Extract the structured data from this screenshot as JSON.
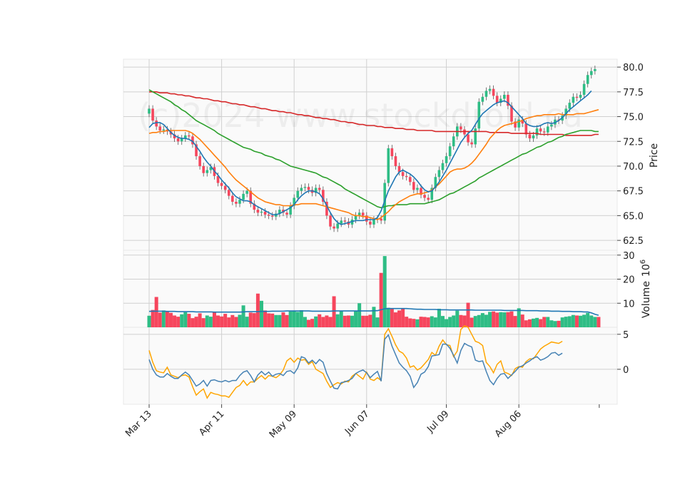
{
  "watermark": "(c)2024 www.stockdroid.ca",
  "colors": {
    "up": "#2ebd85",
    "down": "#f6465d",
    "panel_bg": "#fafafa",
    "grid": "#d0d0d0",
    "ma_fast": "#1f77b4",
    "ma_mid": "#ff7f0e",
    "ma_slow": "#2ca02c",
    "ma_long": "#d62728",
    "vol_ma": "#1f77b4",
    "osc_a": "#4682b4",
    "osc_b": "#ffa500"
  },
  "chart_data": {
    "type": "candlestick",
    "x_ticks": [
      "Mar 13",
      "Apr 11",
      "May 09",
      "Jun 07",
      "Jul 09",
      "Aug 06"
    ],
    "price_panel": {
      "ylabel": "Price",
      "yticks": [
        "62.5",
        "65.0",
        "67.5",
        "70.0",
        "72.5",
        "75.0",
        "77.5",
        "80.0"
      ],
      "ylim": [
        61.5,
        80.8
      ],
      "close": [
        75.8,
        74.6,
        74.0,
        73.6,
        73.7,
        73.5,
        73.2,
        72.8,
        72.5,
        72.8,
        73.1,
        73.0,
        72.2,
        71.0,
        70.0,
        69.3,
        69.6,
        69.9,
        69.0,
        68.3,
        68.0,
        67.6,
        67.0,
        66.4,
        66.2,
        66.6,
        67.2,
        67.5,
        66.2,
        65.6,
        65.3,
        65.4,
        65.1,
        65.0,
        64.9,
        65.2,
        65.6,
        65.3,
        65.1,
        66.0,
        66.8,
        67.5,
        67.8,
        67.9,
        67.6,
        67.3,
        67.8,
        67.6,
        66.4,
        65.0,
        63.9,
        63.7,
        64.2,
        64.5,
        64.4,
        64.1,
        64.6,
        65.0,
        65.3,
        65.0,
        64.4,
        64.1,
        64.6,
        64.7,
        64.5,
        68.3,
        71.8,
        71.0,
        70.0,
        69.4,
        69.0,
        68.9,
        68.4,
        67.6,
        67.8,
        67.1,
        66.8,
        66.6,
        67.8,
        68.9,
        69.6,
        70.3,
        71.0,
        72.0,
        73.0,
        74.0,
        73.7,
        73.2,
        72.4,
        72.2,
        73.8,
        76.5,
        77.0,
        77.6,
        77.8,
        77.1,
        76.4,
        76.8,
        77.2,
        76.1,
        74.5,
        73.9,
        74.7,
        74.3,
        73.2,
        72.8,
        73.1,
        73.8,
        73.5,
        73.4,
        74.0,
        74.2,
        74.7,
        74.6,
        75.1,
        75.8,
        76.4,
        77.0,
        76.9,
        77.2,
        78.3,
        79.2,
        79.6,
        79.8
      ],
      "ma_fast": [
        73.9,
        74.3,
        74.4,
        74.4,
        74.2,
        73.8,
        73.4,
        73.1,
        72.9,
        72.8,
        72.8,
        72.7,
        72.5,
        72.0,
        71.5,
        70.9,
        70.4,
        70.0,
        69.5,
        69.1,
        68.6,
        68.2,
        67.8,
        67.3,
        66.9,
        66.7,
        66.5,
        66.5,
        66.4,
        66.1,
        65.9,
        65.7,
        65.5,
        65.3,
        65.1,
        65.1,
        65.2,
        65.4,
        65.6,
        65.8,
        66.1,
        66.6,
        67.0,
        67.3,
        67.5,
        67.5,
        67.4,
        67.2,
        66.7,
        66.0,
        65.3,
        64.7,
        64.3,
        64.1,
        64.2,
        64.3,
        64.4,
        64.5,
        64.5,
        64.5,
        64.6,
        64.6,
        64.6,
        64.8,
        65.5,
        66.5,
        67.5,
        68.2,
        68.9,
        69.4,
        69.6,
        69.4,
        69.2,
        68.9,
        68.5,
        68.0,
        67.6,
        67.4,
        67.5,
        67.9,
        68.4,
        69.0,
        69.6,
        70.3,
        71.0,
        71.7,
        72.4,
        72.9,
        73.3,
        73.6,
        74.2,
        74.8,
        75.3,
        75.6,
        75.9,
        76.2,
        76.4,
        76.5,
        76.6,
        76.4,
        76.0,
        75.6,
        75.2,
        74.8,
        74.3,
        74.1,
        74.0,
        74.0,
        74.1,
        74.3,
        74.4,
        74.3,
        74.4,
        74.6,
        74.9,
        75.3,
        75.7,
        76.0,
        76.3,
        76.6,
        76.9,
        77.2,
        77.6
      ],
      "ma_mid": [
        73.3,
        73.4,
        73.4,
        73.5,
        73.5,
        73.6,
        73.6,
        73.6,
        73.6,
        73.6,
        73.6,
        73.5,
        73.3,
        73.0,
        72.7,
        72.3,
        71.9,
        71.5,
        71.1,
        70.7,
        70.3,
        69.9,
        69.4,
        69.0,
        68.6,
        68.3,
        68.0,
        67.7,
        67.4,
        67.1,
        66.8,
        66.6,
        66.4,
        66.3,
        66.2,
        66.1,
        66.1,
        66.0,
        66.0,
        66.0,
        66.1,
        66.1,
        66.2,
        66.2,
        66.2,
        66.2,
        66.2,
        66.1,
        66.0,
        65.9,
        65.8,
        65.7,
        65.6,
        65.5,
        65.4,
        65.3,
        65.1,
        65.0,
        65.0,
        64.9,
        64.9,
        64.8,
        64.7,
        64.6,
        64.8,
        65.1,
        65.4,
        65.8,
        66.1,
        66.4,
        66.6,
        66.8,
        67.0,
        67.1,
        67.2,
        67.2,
        67.3,
        67.4,
        67.6,
        67.9,
        68.2,
        68.6,
        69.0,
        69.4,
        69.6,
        69.7,
        69.7,
        69.8,
        70.0,
        70.3,
        70.7,
        71.2,
        71.7,
        72.2,
        72.8,
        73.2,
        73.6,
        73.9,
        74.1,
        74.2,
        74.3,
        74.4,
        74.5,
        74.6,
        74.8,
        74.9,
        75.0,
        75.1,
        75.1,
        75.2,
        75.2,
        75.2,
        75.2,
        75.3,
        75.2,
        75.2,
        75.2,
        75.2,
        75.3,
        75.3,
        75.3,
        75.4,
        75.5,
        75.6,
        75.7
      ],
      "ma_slow": [
        77.7,
        77.5,
        77.3,
        77.1,
        76.9,
        76.7,
        76.5,
        76.2,
        76.0,
        75.7,
        75.5,
        75.2,
        74.9,
        74.6,
        74.4,
        74.2,
        74.0,
        73.8,
        73.6,
        73.3,
        73.1,
        72.9,
        72.7,
        72.5,
        72.3,
        72.1,
        71.9,
        71.8,
        71.7,
        71.5,
        71.4,
        71.3,
        71.1,
        71.0,
        70.9,
        70.7,
        70.6,
        70.4,
        70.2,
        70.0,
        69.9,
        69.8,
        69.7,
        69.6,
        69.5,
        69.4,
        69.3,
        69.1,
        68.9,
        68.8,
        68.6,
        68.4,
        68.2,
        68.0,
        67.7,
        67.5,
        67.3,
        67.1,
        66.9,
        66.7,
        66.5,
        66.3,
        66.1,
        65.9,
        65.8,
        65.9,
        66.0,
        66.0,
        66.1,
        66.1,
        66.1,
        66.1,
        66.2,
        66.2,
        66.2,
        66.2,
        66.2,
        66.3,
        66.4,
        66.5,
        66.6,
        66.8,
        67.0,
        67.2,
        67.3,
        67.5,
        67.7,
        67.9,
        68.1,
        68.3,
        68.5,
        68.8,
        69.0,
        69.2,
        69.4,
        69.6,
        69.8,
        70.0,
        70.2,
        70.4,
        70.6,
        70.8,
        71.0,
        71.2,
        71.3,
        71.5,
        71.7,
        71.9,
        72.0,
        72.2,
        72.4,
        72.5,
        72.7,
        72.9,
        73.0,
        73.2,
        73.3,
        73.4,
        73.5,
        73.6,
        73.6,
        73.6,
        73.6,
        73.5,
        73.5
      ],
      "ma_long": [
        77.5,
        77.5,
        77.5,
        77.4,
        77.4,
        77.4,
        77.3,
        77.3,
        77.2,
        77.2,
        77.1,
        77.1,
        77.0,
        76.9,
        76.9,
        76.8,
        76.8,
        76.7,
        76.6,
        76.6,
        76.5,
        76.5,
        76.4,
        76.3,
        76.3,
        76.2,
        76.2,
        76.1,
        76.0,
        76.0,
        75.9,
        75.8,
        75.8,
        75.7,
        75.6,
        75.6,
        75.5,
        75.5,
        75.4,
        75.4,
        75.3,
        75.2,
        75.2,
        75.1,
        75.1,
        75.0,
        74.9,
        74.9,
        74.8,
        74.8,
        74.7,
        74.7,
        74.6,
        74.5,
        74.5,
        74.4,
        74.4,
        74.3,
        74.2,
        74.2,
        74.1,
        74.1,
        74.1,
        74.0,
        74.0,
        73.9,
        73.9,
        73.9,
        73.8,
        73.8,
        73.8,
        73.7,
        73.7,
        73.7,
        73.6,
        73.6,
        73.6,
        73.6,
        73.6,
        73.5,
        73.5,
        73.5,
        73.5,
        73.5,
        73.5,
        73.5,
        73.5,
        73.5,
        73.5,
        73.5,
        73.5,
        73.5,
        73.5,
        73.5,
        73.4,
        73.4,
        73.4,
        73.4,
        73.4,
        73.4,
        73.3,
        73.3,
        73.3,
        73.3,
        73.3,
        73.3,
        73.3,
        73.3,
        73.2,
        73.2,
        73.2,
        73.2,
        73.2,
        73.2,
        73.2,
        73.1,
        73.1,
        73.1,
        73.1,
        73.1,
        73.1,
        73.1,
        73.1,
        73.2,
        73.2
      ]
    },
    "volume_panel": {
      "ylabel": "Volume  10^6",
      "ylabel_main": "Volume",
      "ylabel_exp_base": "10",
      "ylabel_exp": "6",
      "yticks": [
        "10",
        "20",
        "30"
      ],
      "ylim": [
        0,
        32
      ],
      "values": [
        4.8,
        7.2,
        12.6,
        6.1,
        7.0,
        6.5,
        6.0,
        4.9,
        4.4,
        5.4,
        6.3,
        5.6,
        3.8,
        4.4,
        5.8,
        3.8,
        4.9,
        4.4,
        6.5,
        4.9,
        4.5,
        5.6,
        4.1,
        5.1,
        4.3,
        5.2,
        9.1,
        4.4,
        6.1,
        5.9,
        14.0,
        11.0,
        7.0,
        5.8,
        5.7,
        5.1,
        5.1,
        6.2,
        5.1,
        6.6,
        6.9,
        6.4,
        7.1,
        4.3,
        3.1,
        3.5,
        4.5,
        5.4,
        4.3,
        4.9,
        4.3,
        12.9,
        5.4,
        6.9,
        4.8,
        4.9,
        4.8,
        6.8,
        10.0,
        4.8,
        4.8,
        5.2,
        8.5,
        4.1,
        22.6,
        29.6,
        8.1,
        7.8,
        6.2,
        7.0,
        7.8,
        4.4,
        3.7,
        3.5,
        3.3,
        4.4,
        4.3,
        4.1,
        4.6,
        4.1,
        7.7,
        4.7,
        3.4,
        4.3,
        4.9,
        6.9,
        5.1,
        4.9,
        10.2,
        4.0,
        4.7,
        5.1,
        5.9,
        5.2,
        6.4,
        6.6,
        6.1,
        6.3,
        6.2,
        6.3,
        6.6,
        4.7,
        7.9,
        5.3,
        2.9,
        3.3,
        3.6,
        3.9,
        3.4,
        4.3,
        4.3,
        2.9,
        2.6,
        2.7,
        4.1,
        4.4,
        4.6,
        5.1,
        4.9,
        4.8,
        5.2,
        6.0,
        4.9,
        4.3,
        4.3
      ],
      "ma": [
        6.6,
        6.7,
        6.7,
        6.7,
        6.7,
        6.6,
        6.6,
        6.6,
        6.5,
        6.5,
        6.5,
        6.5,
        6.5,
        6.4,
        6.4,
        6.4,
        6.4,
        6.4,
        6.3,
        6.3,
        6.3,
        6.3,
        6.3,
        6.3,
        6.3,
        6.3,
        6.4,
        6.5,
        6.5,
        6.5,
        6.5,
        6.6,
        6.6,
        6.6,
        6.7,
        6.7,
        6.7,
        6.7,
        6.8,
        6.8,
        6.8,
        6.8,
        6.8,
        6.8,
        6.8,
        6.7,
        6.7,
        6.7,
        6.7,
        6.7,
        6.7,
        6.8,
        6.8,
        6.8,
        6.8,
        6.8,
        6.8,
        6.8,
        6.8,
        6.8,
        6.8,
        6.8,
        6.9,
        6.9,
        7.3,
        7.7,
        7.8,
        7.8,
        7.8,
        7.8,
        7.8,
        7.8,
        7.7,
        7.6,
        7.5,
        7.5,
        7.4,
        7.4,
        7.4,
        7.4,
        7.3,
        7.3,
        7.3,
        7.2,
        7.2,
        7.2,
        7.2,
        7.2,
        7.2,
        7.2,
        7.1,
        7.1,
        7.1,
        7.1,
        7.1,
        7.1,
        7.1,
        7.1,
        7.0,
        7.0,
        7.0,
        7.0,
        7.0,
        7.0,
        6.9,
        6.9,
        6.9,
        6.9,
        6.8,
        6.8,
        6.8,
        6.7,
        6.7,
        6.7,
        6.6,
        6.6,
        6.6,
        6.5,
        6.5,
        6.5,
        6.4,
        6.4,
        6.0,
        5.4,
        5.0
      ]
    },
    "oscillator_panel": {
      "yticks": [
        "0",
        "5"
      ],
      "ylim": [
        -5.0,
        6.0
      ],
      "line_a": [
        1.4,
        0.0,
        -0.8,
        -1.1,
        -1.1,
        -0.6,
        -1.0,
        -1.3,
        -1.3,
        -0.8,
        -0.4,
        -0.8,
        -1.6,
        -2.4,
        -2.1,
        -1.6,
        -2.4,
        -1.6,
        -1.5,
        -1.7,
        -1.8,
        -1.6,
        -1.8,
        -1.6,
        -1.6,
        -0.9,
        -0.4,
        -0.2,
        -0.9,
        -1.8,
        -0.8,
        -0.3,
        -0.8,
        -0.4,
        -1.0,
        -0.7,
        -0.6,
        -0.9,
        -0.3,
        -0.2,
        -0.6,
        0.2,
        1.8,
        1.6,
        0.9,
        1.3,
        0.8,
        1.4,
        1.0,
        -0.6,
        -1.7,
        -2.7,
        -2.8,
        -1.9,
        -1.8,
        -1.6,
        -1.3,
        -0.6,
        -0.3,
        -0.1,
        -0.5,
        -1.2,
        -0.7,
        -0.3,
        -1.7,
        4.3,
        4.9,
        3.3,
        2.1,
        0.9,
        0.3,
        -0.2,
        -1.0,
        -2.6,
        -1.9,
        -0.7,
        -0.4,
        0.4,
        1.9,
        2.0,
        2.1,
        3.6,
        3.6,
        3.0,
        2.0,
        0.9,
        2.7,
        3.7,
        3.4,
        3.2,
        1.3,
        1.1,
        1.2,
        -0.3,
        -1.6,
        -2.2,
        -1.3,
        -0.7,
        -0.6,
        -1.3,
        -0.8,
        -0.3,
        0.3,
        0.5,
        0.9,
        1.2,
        1.6,
        1.8,
        1.3,
        1.5,
        1.8,
        2.3,
        2.4,
        2.0,
        2.3
      ],
      "line_b": [
        2.7,
        1.0,
        -0.2,
        -0.4,
        -0.5,
        0.3,
        -0.8,
        -1.0,
        -1.2,
        -0.9,
        -0.8,
        -1.1,
        -2.5,
        -3.7,
        -3.2,
        -2.8,
        -4.1,
        -3.3,
        -3.5,
        -3.6,
        -3.8,
        -3.8,
        -4.0,
        -3.3,
        -2.6,
        -2.3,
        -1.6,
        -2.3,
        -1.8,
        -1.8,
        -1.3,
        -0.9,
        -1.4,
        -0.9,
        -1.0,
        -1.2,
        -0.8,
        -0.1,
        1.2,
        1.6,
        1.0,
        1.6,
        1.3,
        1.4,
        0.7,
        1.1,
        0.0,
        -0.3,
        -0.6,
        -1.7,
        -2.6,
        -2.2,
        -1.9,
        -2.1,
        -1.7,
        -1.8,
        -1.0,
        -0.6,
        -1.0,
        -1.4,
        -0.4,
        -1.4,
        -1.6,
        -1.2,
        -1.6,
        5.0,
        5.8,
        4.7,
        3.5,
        2.6,
        2.3,
        1.6,
        0.3,
        0.5,
        -0.1,
        0.2,
        0.8,
        1.4,
        2.4,
        2.0,
        3.3,
        4.2,
        3.5,
        3.4,
        1.8,
        2.6,
        5.7,
        6.2,
        6.0,
        5.0,
        4.0,
        3.8,
        3.4,
        1.0,
        0.4,
        -0.5,
        0.7,
        1.2,
        -0.4,
        -0.6,
        -0.9,
        0.1,
        0.4,
        0.3,
        1.1,
        1.5,
        1.5,
        2.2,
        2.9,
        3.3,
        3.6,
        3.9,
        3.8,
        3.7,
        4.0
      ]
    }
  }
}
